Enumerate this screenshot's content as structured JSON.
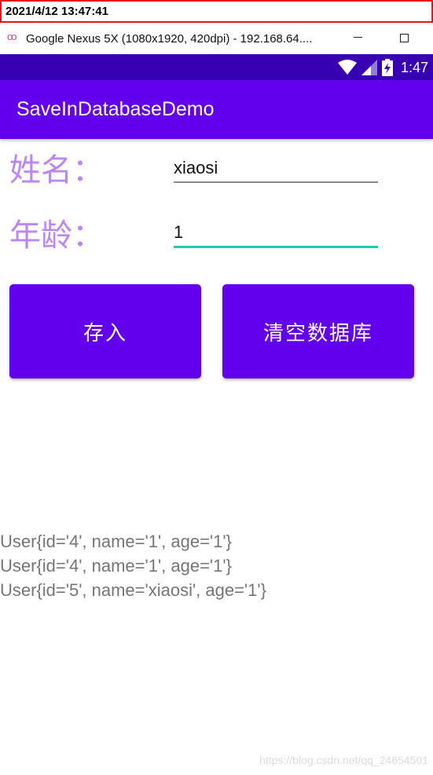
{
  "capture": {
    "timestamp": "2021/4/12 13:47:41"
  },
  "window": {
    "title": "Google Nexus 5X (1080x1920, 420dpi) - 192.168.64...."
  },
  "statusbar": {
    "time": "1:47"
  },
  "appbar": {
    "title": "SaveInDatabaseDemo"
  },
  "form": {
    "name_label": "姓名：",
    "name_value": "xiaosi",
    "age_label": "年龄：",
    "age_value": "1"
  },
  "buttons": {
    "save_label": "存入",
    "clear_label": "清空数据库"
  },
  "records": [
    "User{id='4', name='1', age='1'}",
    "User{id='4', name='1', age='1'}",
    "User{id='5', name='xiaosi', age='1'}"
  ],
  "watermark": "https://blog.csdn.net/qq_24654501",
  "colors": {
    "primary": "#6200ee",
    "primary_dark": "#3700b3",
    "label": "#bb86fc",
    "accent": "#20c8b8"
  }
}
